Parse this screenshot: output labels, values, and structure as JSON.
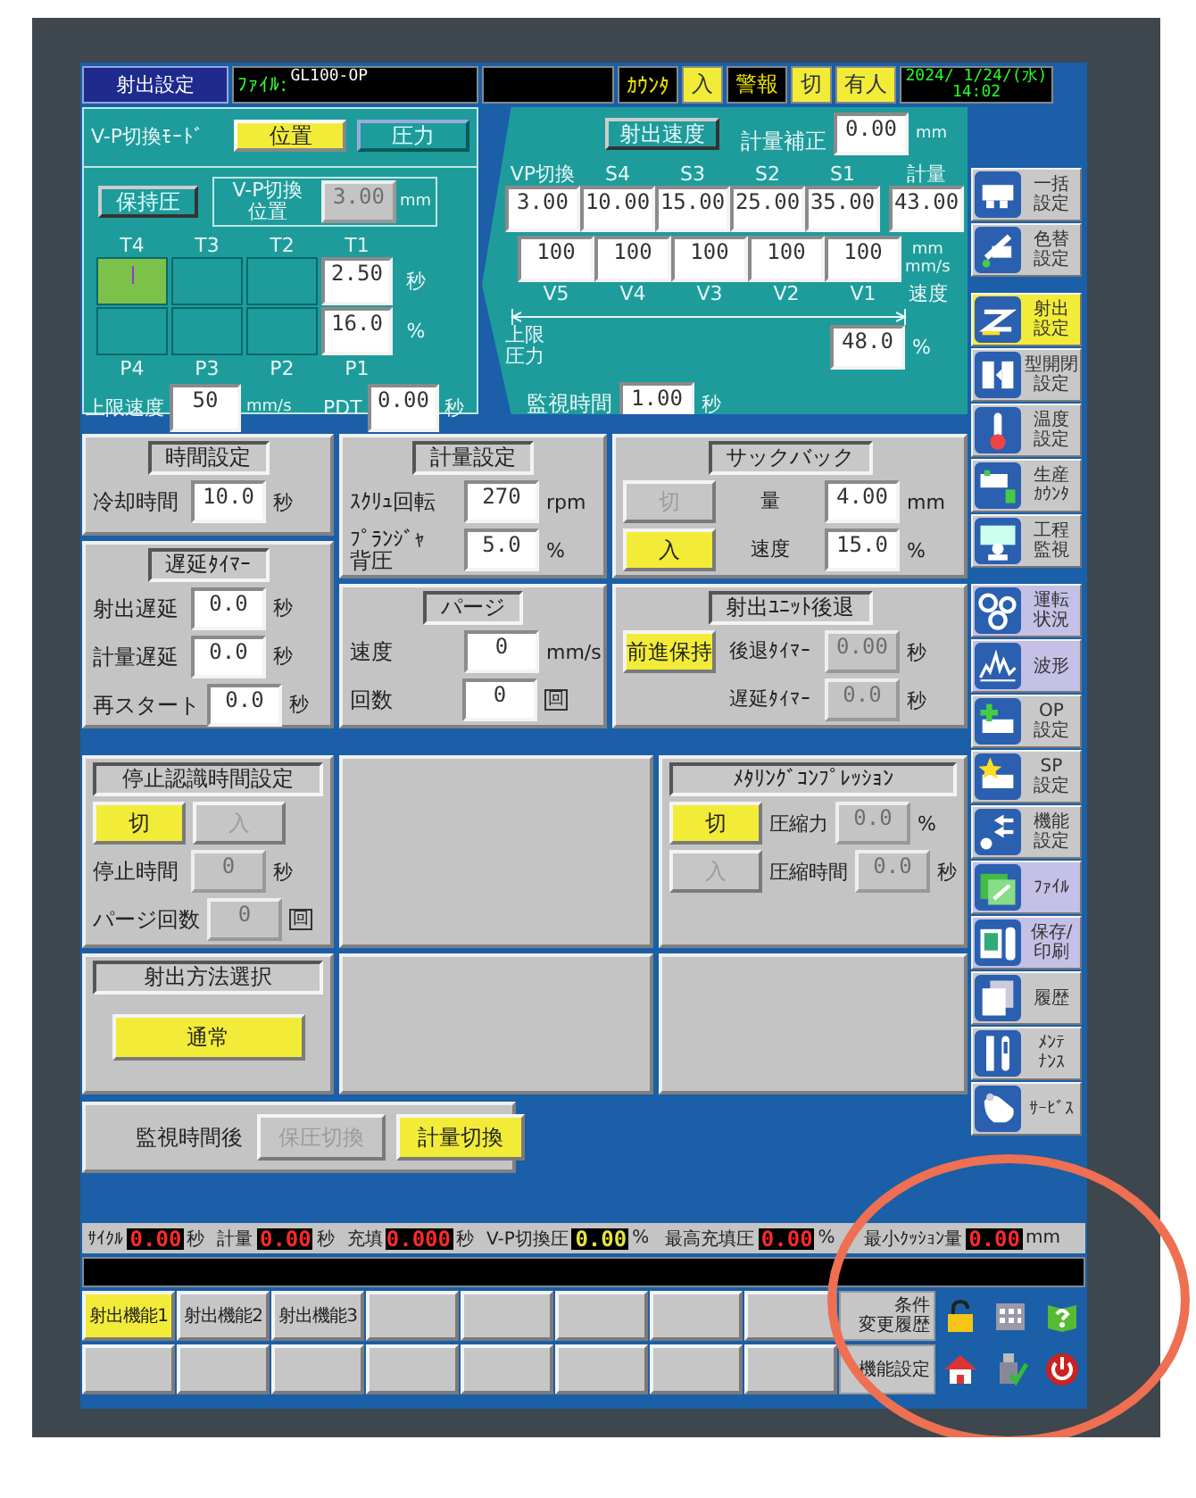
{
  "header": {
    "title": "射出設定",
    "file_label": "ﾌｧｲﾙ:",
    "file_name": "GL100-OP",
    "indicators": [
      {
        "label": "ｶｳﾝﾀ",
        "lit": false
      },
      {
        "label": "入",
        "lit": true
      },
      {
        "label": "警報",
        "lit": false
      },
      {
        "label": "切",
        "lit": true
      },
      {
        "label": "有人",
        "lit": true
      }
    ],
    "date": "2024/ 1/24/(水)",
    "time": "14:02"
  },
  "vp_panel": {
    "mode_label": "V-P切換ﾓｰﾄﾞ",
    "modes": [
      {
        "label": "位置",
        "selected": true
      },
      {
        "label": "圧力",
        "selected": false
      }
    ],
    "hold_button": "保持圧",
    "switch_position": {
      "lines": [
        "V-P切換",
        "位置"
      ],
      "value": "3.00",
      "unit": "mm",
      "disabled": true
    },
    "stages": [
      {
        "time_label": "T4",
        "pressure_label": "P4",
        "active": true
      },
      {
        "time_label": "T3",
        "pressure_label": "P3",
        "active": false
      },
      {
        "time_label": "T2",
        "pressure_label": "P2",
        "active": false
      },
      {
        "time_label": "T1",
        "pressure_label": "P1",
        "time": "2.50",
        "pressure": "16.0",
        "active": false
      }
    ],
    "time_unit": "秒",
    "pressure_unit": "%",
    "speed_limit": {
      "label": "上限速度",
      "value": "50",
      "unit": "mm/s"
    },
    "pdt": {
      "label": "PDT",
      "value": "0.00",
      "unit": "秒"
    }
  },
  "speed_panel": {
    "title": "射出速度",
    "metering_comp": {
      "label": "計量補正",
      "value": "0.00",
      "unit": "mm"
    },
    "positions": [
      {
        "label": "VP切換",
        "value": "3.00"
      },
      {
        "label": "S4",
        "value": "10.00"
      },
      {
        "label": "S3",
        "value": "15.00"
      },
      {
        "label": "S2",
        "value": "25.00"
      },
      {
        "label": "S1",
        "value": "35.00"
      }
    ],
    "metering": {
      "label": "計量",
      "value": "43.00"
    },
    "position_unit": "mm",
    "speeds": [
      {
        "label": "V5",
        "value": "100"
      },
      {
        "label": "V4",
        "value": "100"
      },
      {
        "label": "V3",
        "value": "100"
      },
      {
        "label": "V2",
        "value": "100"
      },
      {
        "label": "V1",
        "value": "100"
      }
    ],
    "speed_unit": "mm/s",
    "speed_caption": "速度",
    "pressure_limit": {
      "lines": [
        "上限",
        "圧力"
      ],
      "value": "48.0",
      "unit": "%"
    },
    "monitor_time": {
      "label": "監視時間",
      "value": "1.00",
      "unit": "秒"
    }
  },
  "settings": [
    {
      "panels": [
        {
          "title": "時間設定",
          "rows": [
            {
              "kind": "field",
              "label": "冷却時間",
              "value": "10.0",
              "unit": "秒",
              "disabled": false
            }
          ]
        },
        {
          "title": "遅延ﾀｲﾏｰ",
          "rows": [
            {
              "kind": "field",
              "label": "射出遅延",
              "value": "0.0",
              "unit": "秒",
              "disabled": false
            },
            {
              "kind": "field",
              "label": "計量遅延",
              "value": "0.0",
              "unit": "秒",
              "disabled": false
            },
            {
              "kind": "field",
              "label": "再スタート",
              "value": "0.0",
              "unit": "秒",
              "disabled": false
            }
          ]
        }
      ]
    },
    {
      "panels": [
        {
          "title": "計量設定",
          "rows": [
            {
              "kind": "field",
              "label": "ｽｸﾘｭ回転",
              "value": "270",
              "unit": "rpm",
              "disabled": false
            },
            {
              "kind": "field",
              "lines": [
                "ﾌﾟﾗﾝｼﾞｬ",
                "背圧"
              ],
              "value": "5.0",
              "unit": "%",
              "disabled": false
            }
          ]
        },
        {
          "title": "パージ",
          "rows": [
            {
              "kind": "field",
              "label": "速度",
              "value": "0",
              "unit": "mm/s",
              "disabled": false
            },
            {
              "kind": "field",
              "label": "回数",
              "value": "0",
              "unit": "回",
              "unit_boxed": true,
              "disabled": false
            }
          ]
        }
      ]
    },
    {
      "panels": [
        {
          "title": "サックバック",
          "rows": [
            {
              "kind": "button_field",
              "button": {
                "label": "切",
                "selected": false
              },
              "label": "量",
              "value": "4.00",
              "unit": "mm",
              "disabled": false
            },
            {
              "kind": "button_field",
              "button": {
                "label": "入",
                "selected": true
              },
              "label": "速度",
              "value": "15.0",
              "unit": "%",
              "disabled": false
            }
          ]
        },
        {
          "title": "射出ﾕﾆｯﾄ後退",
          "rows": [
            {
              "kind": "button_field",
              "button": {
                "label": "前進保持",
                "selected": true
              },
              "label": "後退ﾀｲﾏｰ",
              "value": "0.00",
              "unit": "秒",
              "disabled": true
            },
            {
              "kind": "button_field",
              "label": "遅延ﾀｲﾏｰ",
              "value": "0.0",
              "unit": "秒",
              "disabled": true
            }
          ]
        }
      ]
    }
  ],
  "lower": {
    "left": [
      {
        "title": "停止認識時間設定",
        "rows": [
          {
            "kind": "buttons",
            "buttons": [
              {
                "label": "切",
                "selected": true
              },
              {
                "label": "入",
                "selected": false
              }
            ]
          },
          {
            "kind": "field",
            "label": "停止時間",
            "value": "0",
            "unit": "秒",
            "disabled": true
          },
          {
            "kind": "field",
            "label": "パージ回数",
            "value": "0",
            "unit": "回",
            "unit_boxed": true,
            "disabled": true
          }
        ]
      },
      {
        "title": "射出方法選択",
        "rows": [
          {
            "kind": "buttons",
            "buttons": [
              {
                "label": "通常",
                "selected": true
              }
            ]
          }
        ]
      }
    ],
    "right": [
      {
        "title": "ﾒﾀﾘﾝｸﾞｺﾝﾌﾟﾚｯｼｮﾝ",
        "rows": [
          {
            "kind": "button_field",
            "button": {
              "label": "切",
              "selected": true
            },
            "label": "圧縮力",
            "value": "0.0",
            "unit": "%",
            "disabled": true
          },
          {
            "kind": "button_field",
            "button": {
              "label": "入",
              "selected": false
            },
            "label": "圧縮時間",
            "value": "0.0",
            "unit": "秒",
            "disabled": true
          }
        ]
      }
    ]
  },
  "after_monitor": {
    "label": "監視時間後",
    "options": [
      {
        "label": "保圧切換",
        "selected": false
      },
      {
        "label": "計量切換",
        "selected": true
      }
    ]
  },
  "sidebar": {
    "groups": [
      {
        "items": [
          {
            "lines": [
              "一括",
              "設定"
            ],
            "selected": false,
            "color": "#c8c8c8"
          },
          {
            "lines": [
              "色替",
              "設定"
            ],
            "selected": false,
            "color": "#c8c8c8"
          }
        ]
      },
      {
        "items": [
          {
            "lines": [
              "射出",
              "設定"
            ],
            "selected": true
          },
          {
            "lines": [
              "型開閉",
              "設定"
            ],
            "selected": false,
            "color": "#c8c8c8"
          },
          {
            "lines": [
              "温度",
              "設定"
            ],
            "selected": false,
            "color": "#c8c8c8"
          },
          {
            "lines": [
              "生産",
              "ｶｳﾝﾀ"
            ],
            "selected": false,
            "color": "#c8c8c8"
          },
          {
            "lines": [
              "工程",
              "監視"
            ],
            "selected": false,
            "color": "#c8c8c8"
          }
        ]
      },
      {
        "items": [
          {
            "lines": [
              "運転",
              "状況"
            ],
            "selected": false,
            "color": "#c4c0e6"
          },
          {
            "lines": [
              "波形"
            ],
            "selected": false,
            "color": "#c4c0e6"
          },
          {
            "lines": [
              "OP",
              "設定"
            ],
            "selected": false,
            "color": "#c8c8c8"
          },
          {
            "lines": [
              "SP",
              "設定"
            ],
            "selected": false,
            "color": "#c8c8c8"
          },
          {
            "lines": [
              "機能",
              "設定"
            ],
            "selected": false,
            "color": "#c8c8c8"
          },
          {
            "lines": [
              "ﾌｧｲﾙ"
            ],
            "selected": false,
            "color": "#c4c0e6"
          },
          {
            "lines": [
              "保存/",
              "印刷"
            ],
            "selected": false,
            "color": "#c4c0e6"
          },
          {
            "lines": [
              "履歴"
            ],
            "selected": false,
            "color": "#c8c8c8"
          },
          {
            "lines": [
              "ﾒﾝﾃ",
              "ﾅﾝｽ"
            ],
            "selected": false,
            "color": "#c8c8c8"
          },
          {
            "lines": [
              "ｻｰﾋﾞｽ"
            ],
            "selected": false,
            "color": "#c8c8c8"
          }
        ]
      }
    ]
  },
  "monitor_values": {
    "left": [
      {
        "label": "ｻｲｸﾙ",
        "value": "0.00",
        "unit": "秒",
        "kind": "actual"
      },
      {
        "label": "計量",
        "value": "0.00",
        "unit": "秒",
        "kind": "actual"
      },
      {
        "label": "充填",
        "value": "0.000",
        "unit": "秒",
        "kind": "actual"
      },
      {
        "label": "V-P切換圧",
        "value": "0.00",
        "unit": "%",
        "kind": "switch"
      }
    ],
    "right": [
      {
        "label": "最高充填圧",
        "value": "0.00",
        "unit": "%",
        "kind": "actual"
      },
      {
        "label": "最小ｸｯｼｮﾝ量",
        "value": "0.00",
        "unit": "mm",
        "kind": "actual"
      }
    ]
  },
  "function_keys": {
    "keys": [
      {
        "label": "射出機能1",
        "selected": true
      },
      {
        "label": "射出機能2",
        "selected": false
      },
      {
        "label": "射出機能3",
        "selected": false
      }
    ],
    "side": [
      {
        "lines": [
          "条件",
          "変更履歴"
        ]
      },
      {
        "lines": [
          "機能設定"
        ]
      }
    ]
  }
}
